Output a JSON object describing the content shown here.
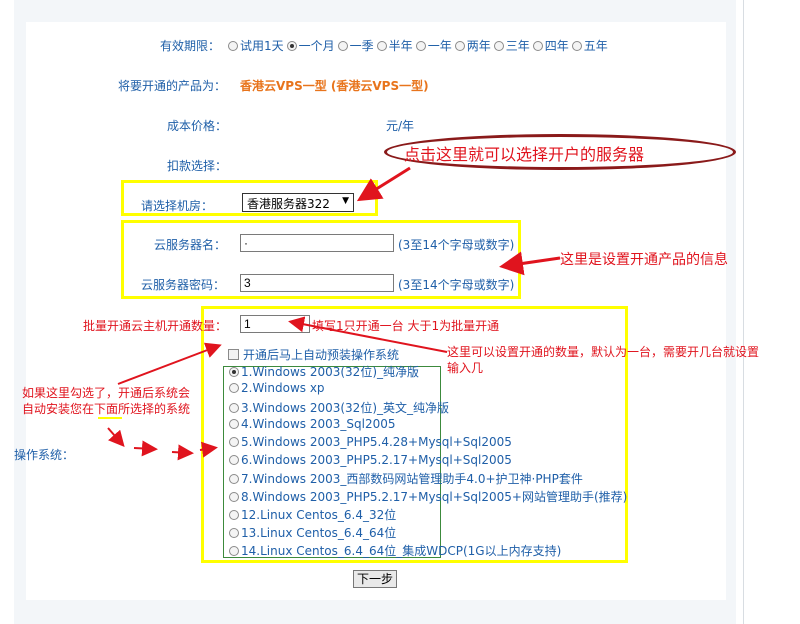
{
  "period": {
    "label": "有效期限：",
    "options": [
      "试用1天",
      "一个月",
      "一季",
      "半年",
      "一年",
      "两年",
      "三年",
      "四年",
      "五年"
    ],
    "selected_index": 1
  },
  "product": {
    "label": "将要开通的产品为：",
    "value": "香港云VPS一型 (香港云VPS一型)"
  },
  "cost": {
    "label": "成本价格：",
    "value": "元/年"
  },
  "deduct": {
    "label": "扣款选择："
  },
  "datacenter": {
    "label": "请选择机房：",
    "value": "香港服务器322"
  },
  "server_name": {
    "label": "云服务器名：",
    "value": "·",
    "hint": "(3至14个字母或数字)"
  },
  "server_password": {
    "label": "云服务器密码：",
    "value": "3",
    "hint": "(3至14个字母或数字)"
  },
  "quantity": {
    "label": "批量开通云主机开通数量：",
    "value": "1",
    "hint": "填写1只开通一台 大于1为批量开通"
  },
  "auto_install": {
    "label": "开通后马上自动预装操作系统"
  },
  "os": {
    "label": "操作系统：",
    "selected_index": 0,
    "items": [
      "1.Windows 2003(32位)_纯净版",
      "2.Windows xp",
      "3.Windows 2003(32位)_英文_纯净版",
      "4.Windows 2003_Sql2005",
      "5.Windows 2003_PHP5.4.28+Mysql+Sql2005",
      "6.Windows 2003_PHP5.2.17+Mysql+Sql2005",
      "7.Windows 2003_西部数码网站管理助手4.0+护卫神·PHP套件",
      "8.Windows 2003_PHP5.2.17+Mysql+Sql2005+网站管理助手(推荐)",
      "12.Linux Centos_6.4_32位",
      "13.Linux Centos_6.4_64位",
      "14.Linux Centos_6.4_64位_集成WDCP(1G以上内存支持)"
    ]
  },
  "next_button": {
    "label": "下一步"
  },
  "annotations": {
    "server_select": "点击这里就可以选择开户的服务器",
    "product_info": "这里是设置开通产品的信息",
    "quantity_line1": "这里可以设置开通的数量，默认为一台，需要开几台就设置",
    "quantity_line2": "输入几",
    "auto_line1": "如果这里勾选了，开通后系统会",
    "auto_line2": "自动安装您在下面所选择的系统"
  },
  "colors": {
    "label_blue": "#1f5fa8",
    "annotation_red": "#e0141e",
    "highlight_yellow": "#ffff00",
    "product_orange": "#e8741c"
  }
}
